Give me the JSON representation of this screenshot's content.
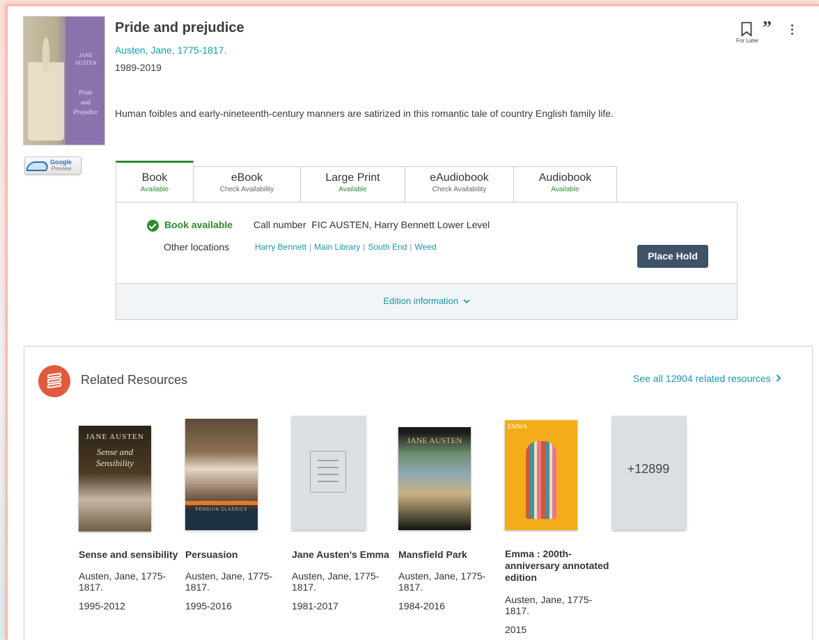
{
  "record": {
    "title": "Pride and prejudice",
    "author": "Austen, Jane, 1775-1817.",
    "years": "1989-2019",
    "summary": "Human foibles and early-nineteenth-century manners are satirized in this romantic tale of country English family life.",
    "cover_text": [
      "JANE",
      "AUSTEN",
      "Pride",
      "and",
      "Prejudice"
    ]
  },
  "actions": {
    "for_later_label": "For Later",
    "cite_icon": "quote-icon",
    "more_icon": "more-vertical-icon"
  },
  "google_preview": {
    "brand": "Google",
    "label": "Preview"
  },
  "formats": {
    "tabs": [
      {
        "name": "Book",
        "status": "Available",
        "status_color": "#2e8b2e"
      },
      {
        "name": "eBook",
        "status": "Check Availability",
        "status_color": "#666666"
      },
      {
        "name": "Large Print",
        "status": "Available",
        "status_color": "#2e8b2e"
      },
      {
        "name": "eAudiobook",
        "status": "Check Availability",
        "status_color": "#666666"
      },
      {
        "name": "Audiobook",
        "status": "Available",
        "status_color": "#2e8b2e"
      }
    ],
    "active_tab": "Book"
  },
  "availability": {
    "status": "Book available",
    "call_number_label": "Call number",
    "call_number": "FIC AUSTEN, Harry Bennett Lower Level",
    "other_locations_label": "Other locations",
    "locations": [
      "Harry Bennett",
      "Main Library",
      "South End",
      "Weed"
    ],
    "place_hold_label": "Place Hold",
    "edition_info_label": "Edition information"
  },
  "related": {
    "heading": "Related Resources",
    "see_all": "See all 12904 related resources",
    "items": [
      {
        "title": "Sense and sensibility",
        "author": "Austen, Jane, 1775-1817.",
        "years": "1995-2012",
        "cover_text": [
          "JANE AUSTEN",
          "Sense and",
          "Sensibility"
        ]
      },
      {
        "title": "Persuasion",
        "author": "Austen, Jane, 1775-1817.",
        "years": "1995-2016",
        "cover_text": [
          "PENGUIN CLASSICS"
        ]
      },
      {
        "title": "Jane Austen's Emma",
        "author": "Austen, Jane, 1775-1817.",
        "years": "1981-2017"
      },
      {
        "title": "Mansfield Park",
        "author": "Austen, Jane, 1775-1817.",
        "years": "1984-2016",
        "cover_text": [
          "JANE AUSTEN"
        ]
      },
      {
        "title": "Emma : 200th-anniversary annotated edition",
        "author": "Austen, Jane, 1775-1817.",
        "years": "2015",
        "cover_text": [
          "EMMA"
        ]
      }
    ],
    "more_count": "+12899"
  },
  "colors": {
    "accent": "#1a95b0",
    "available_green": "#2e8b2e",
    "hold_button": "#3e5367",
    "related_icon": "#e25a3c"
  }
}
